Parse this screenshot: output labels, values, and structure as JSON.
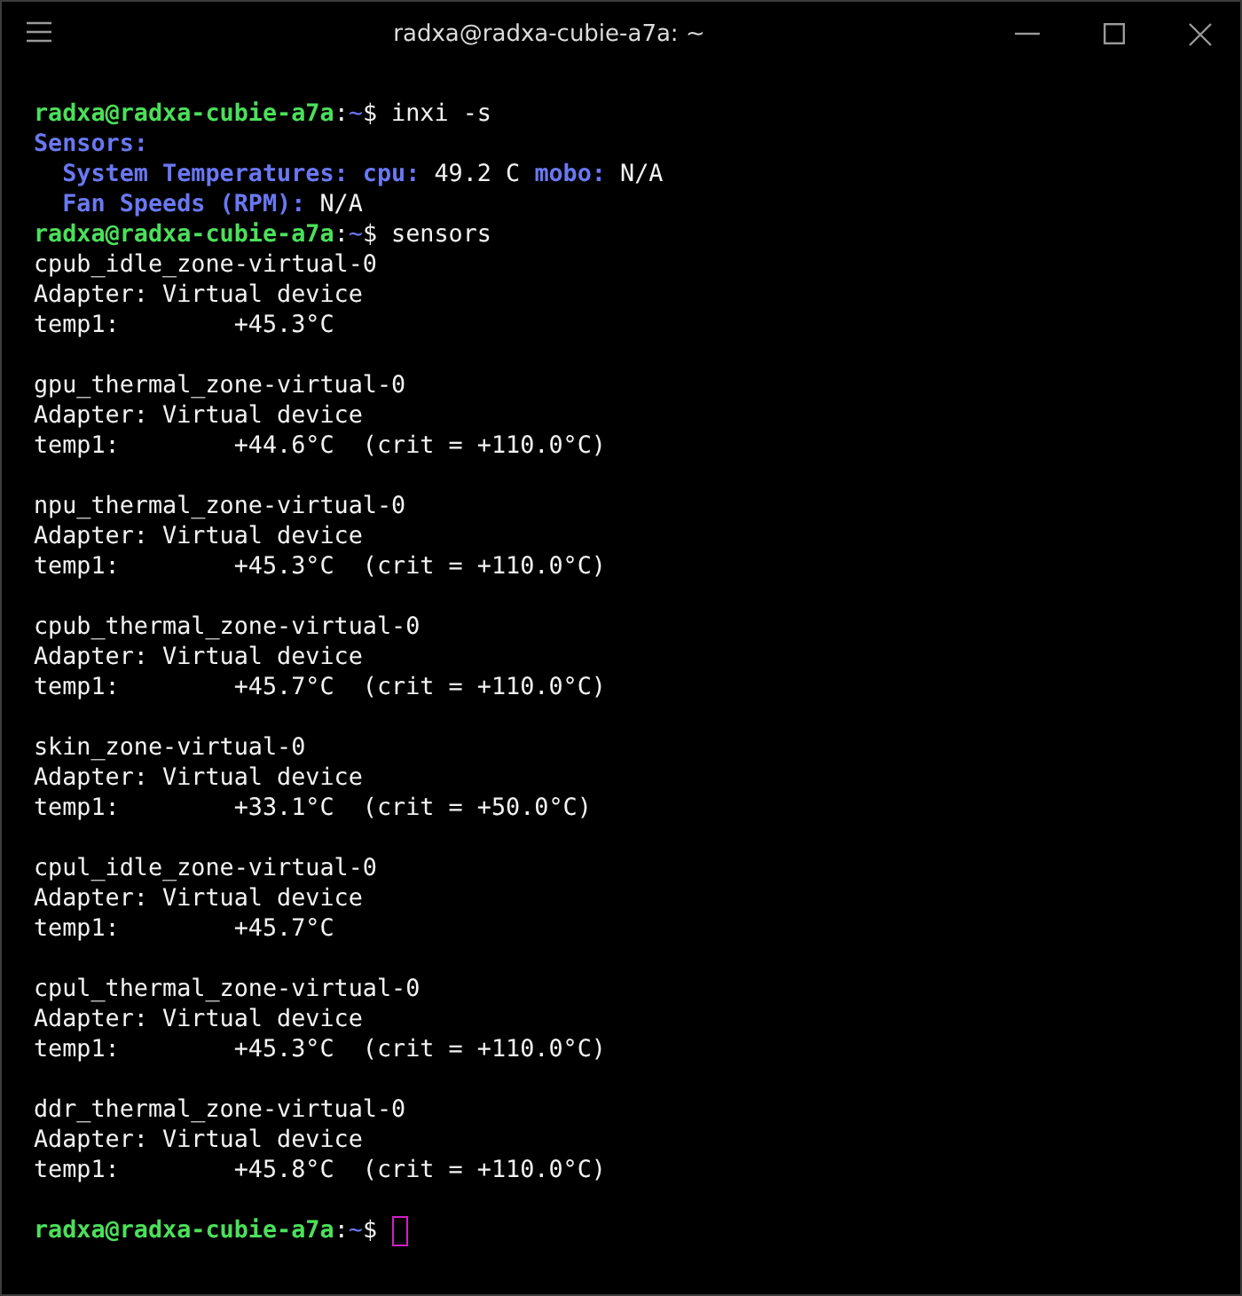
{
  "window": {
    "title": "radxa@radxa-cubie-a7a: ~"
  },
  "lines": [
    {
      "kind": "prompt",
      "user_host": "radxa@radxa-cubie-a7a",
      "separator": ":",
      "path": "~",
      "symbol": "$",
      "command": "inxi -s"
    },
    {
      "kind": "output",
      "segments": [
        {
          "text": "Sensors:",
          "kind": "label"
        }
      ]
    },
    {
      "kind": "output",
      "segments": [
        {
          "text": "  System Temperatures:",
          "kind": "label"
        },
        {
          "text": " cpu:",
          "kind": "label"
        },
        {
          "text": " 49.2 C ",
          "kind": "value"
        },
        {
          "text": "mobo:",
          "kind": "label"
        },
        {
          "text": " N/A",
          "kind": "value"
        }
      ]
    },
    {
      "kind": "output",
      "segments": [
        {
          "text": "  Fan Speeds (RPM):",
          "kind": "label"
        },
        {
          "text": " N/A",
          "kind": "value"
        }
      ]
    },
    {
      "kind": "prompt",
      "user_host": "radxa@radxa-cubie-a7a",
      "separator": ":",
      "path": "~",
      "symbol": "$",
      "command": "sensors"
    },
    {
      "kind": "output",
      "segments": [
        {
          "text": "cpub_idle_zone-virtual-0",
          "kind": "value"
        }
      ]
    },
    {
      "kind": "output",
      "segments": [
        {
          "text": "Adapter: Virtual device",
          "kind": "value"
        }
      ]
    },
    {
      "kind": "output",
      "segments": [
        {
          "text": "temp1:        +45.3°C",
          "kind": "value"
        }
      ]
    },
    {
      "kind": "blank"
    },
    {
      "kind": "output",
      "segments": [
        {
          "text": "gpu_thermal_zone-virtual-0",
          "kind": "value"
        }
      ]
    },
    {
      "kind": "output",
      "segments": [
        {
          "text": "Adapter: Virtual device",
          "kind": "value"
        }
      ]
    },
    {
      "kind": "output",
      "segments": [
        {
          "text": "temp1:        +44.6°C  (crit = +110.0°C)",
          "kind": "value"
        }
      ]
    },
    {
      "kind": "blank"
    },
    {
      "kind": "output",
      "segments": [
        {
          "text": "npu_thermal_zone-virtual-0",
          "kind": "value"
        }
      ]
    },
    {
      "kind": "output",
      "segments": [
        {
          "text": "Adapter: Virtual device",
          "kind": "value"
        }
      ]
    },
    {
      "kind": "output",
      "segments": [
        {
          "text": "temp1:        +45.3°C  (crit = +110.0°C)",
          "kind": "value"
        }
      ]
    },
    {
      "kind": "blank"
    },
    {
      "kind": "output",
      "segments": [
        {
          "text": "cpub_thermal_zone-virtual-0",
          "kind": "value"
        }
      ]
    },
    {
      "kind": "output",
      "segments": [
        {
          "text": "Adapter: Virtual device",
          "kind": "value"
        }
      ]
    },
    {
      "kind": "output",
      "segments": [
        {
          "text": "temp1:        +45.7°C  (crit = +110.0°C)",
          "kind": "value"
        }
      ]
    },
    {
      "kind": "blank"
    },
    {
      "kind": "output",
      "segments": [
        {
          "text": "skin_zone-virtual-0",
          "kind": "value"
        }
      ]
    },
    {
      "kind": "output",
      "segments": [
        {
          "text": "Adapter: Virtual device",
          "kind": "value"
        }
      ]
    },
    {
      "kind": "output",
      "segments": [
        {
          "text": "temp1:        +33.1°C  (crit = +50.0°C)",
          "kind": "value"
        }
      ]
    },
    {
      "kind": "blank"
    },
    {
      "kind": "output",
      "segments": [
        {
          "text": "cpul_idle_zone-virtual-0",
          "kind": "value"
        }
      ]
    },
    {
      "kind": "output",
      "segments": [
        {
          "text": "Adapter: Virtual device",
          "kind": "value"
        }
      ]
    },
    {
      "kind": "output",
      "segments": [
        {
          "text": "temp1:        +45.7°C",
          "kind": "value"
        }
      ]
    },
    {
      "kind": "blank"
    },
    {
      "kind": "output",
      "segments": [
        {
          "text": "cpul_thermal_zone-virtual-0",
          "kind": "value"
        }
      ]
    },
    {
      "kind": "output",
      "segments": [
        {
          "text": "Adapter: Virtual device",
          "kind": "value"
        }
      ]
    },
    {
      "kind": "output",
      "segments": [
        {
          "text": "temp1:        +45.3°C  (crit = +110.0°C)",
          "kind": "value"
        }
      ]
    },
    {
      "kind": "blank"
    },
    {
      "kind": "output",
      "segments": [
        {
          "text": "ddr_thermal_zone-virtual-0",
          "kind": "value"
        }
      ]
    },
    {
      "kind": "output",
      "segments": [
        {
          "text": "Adapter: Virtual device",
          "kind": "value"
        }
      ]
    },
    {
      "kind": "output",
      "segments": [
        {
          "text": "temp1:        +45.8°C  (crit = +110.0°C)",
          "kind": "value"
        }
      ]
    },
    {
      "kind": "blank"
    },
    {
      "kind": "prompt",
      "user_host": "radxa@radxa-cubie-a7a",
      "separator": ":",
      "path": "~",
      "symbol": "$",
      "cursor": true
    }
  ]
}
